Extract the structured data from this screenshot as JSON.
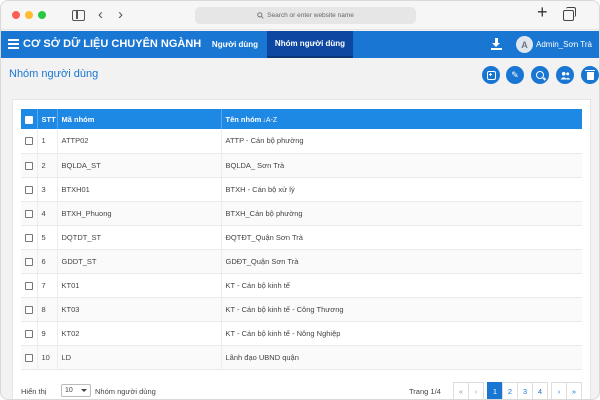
{
  "browser": {
    "address_placeholder": "Search or enter website name",
    "back_glyph": "‹",
    "forward_glyph": "›",
    "new_tab_glyph": "+"
  },
  "app": {
    "title": "CƠ SỞ DỮ LIỆU CHUYÊN NGÀNH",
    "nav": {
      "users": "Người dùng",
      "groups": "Nhóm người dùng"
    },
    "user": {
      "avatar_letter": "A",
      "name": "Admin_Sơn Trà"
    },
    "accent_color": "#1976d2"
  },
  "page": {
    "title": "Nhóm người dùng",
    "toolbar_icons": [
      "add-icon",
      "edit-icon",
      "search-icon",
      "users-icon",
      "delete-icon"
    ]
  },
  "table": {
    "headers": {
      "stt": "STT",
      "code": "Mã nhóm",
      "name": "Tên nhóm",
      "sort_glyph": "↓A-Z"
    },
    "rows": [
      {
        "stt": "1",
        "code": "ATTP02",
        "name": "ATTP - Cán bộ phường"
      },
      {
        "stt": "2",
        "code": "BQLDA_ST",
        "name": "BQLDA_ Sơn Trà"
      },
      {
        "stt": "3",
        "code": "BTXH01",
        "name": "BTXH - Cán bộ xử lý"
      },
      {
        "stt": "4",
        "code": "BTXH_Phuong",
        "name": "BTXH_Cán bộ phường"
      },
      {
        "stt": "5",
        "code": "DQTDT_ST",
        "name": "ĐQTĐT_Quận Sơn Trà"
      },
      {
        "stt": "6",
        "code": "GDDT_ST",
        "name": "GDĐT_Quận Sơn Trà"
      },
      {
        "stt": "7",
        "code": "KT01",
        "name": "KT - Cán bộ kinh tế"
      },
      {
        "stt": "8",
        "code": "KT03",
        "name": "KT - Cán bộ kinh tế - Công Thương"
      },
      {
        "stt": "9",
        "code": "KT02",
        "name": "KT - Cán bộ kinh tế - Nông Nghiệp"
      },
      {
        "stt": "10",
        "code": "LD",
        "name": "Lãnh đạo UBND quận"
      }
    ]
  },
  "footer": {
    "show_label": "Hiển thị",
    "page_size": "10",
    "after_label": "Nhóm người dùng",
    "page_info": "Trang 1/4",
    "pager": {
      "first": "«",
      "prev": "‹",
      "pages": [
        "1",
        "2",
        "3",
        "4"
      ],
      "next": "›",
      "last": "»",
      "active_page": "1"
    }
  }
}
